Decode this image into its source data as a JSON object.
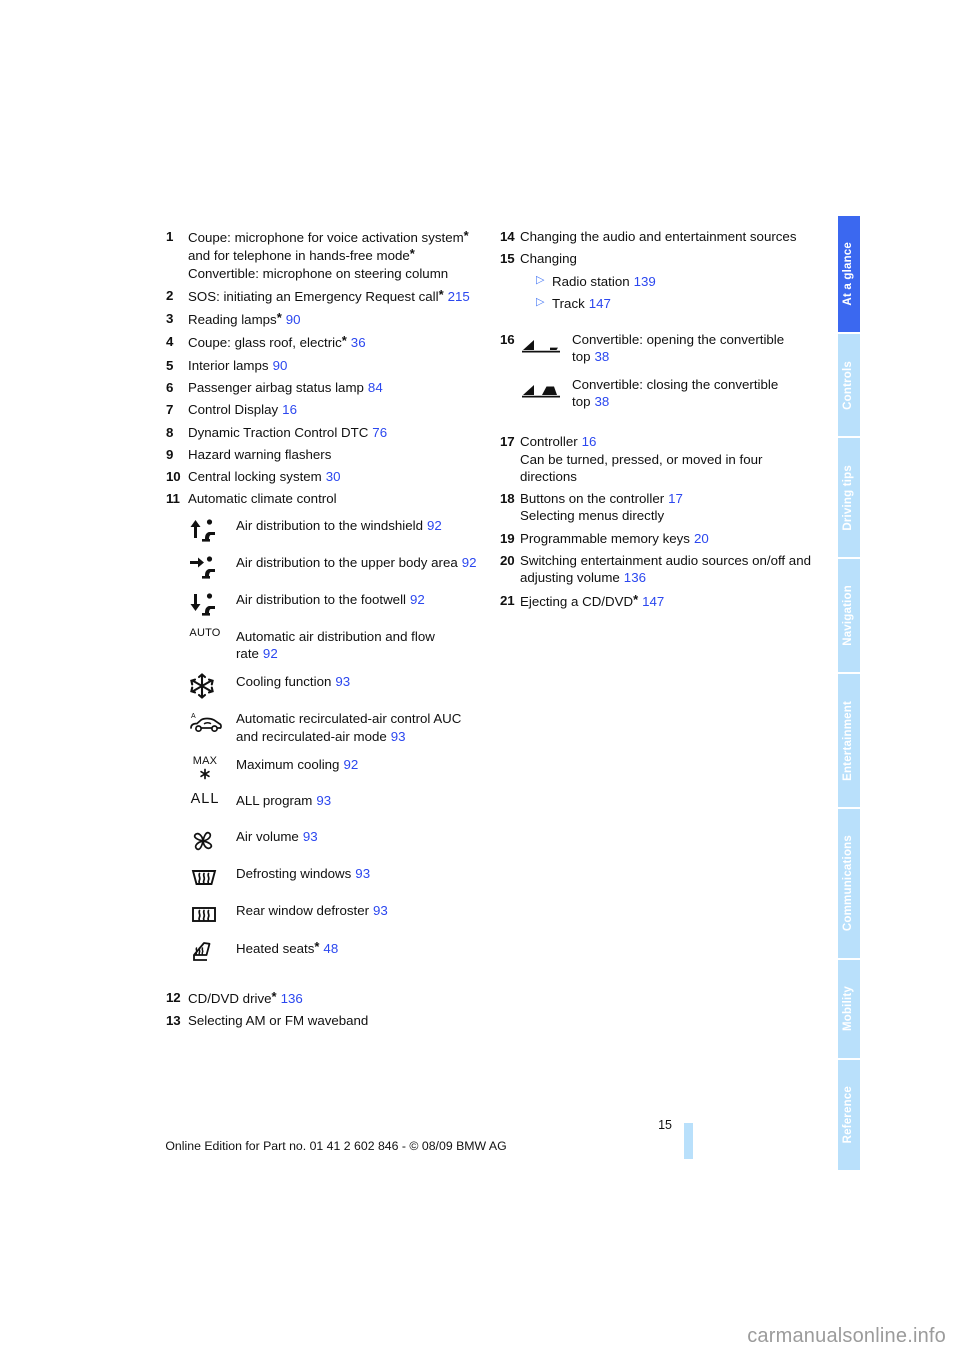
{
  "document": {
    "page_number": "15",
    "footer_text": "Online Edition for Part no. 01 41 2 602 846 - © 08/09 BMW AG",
    "watermark": "carmanualsonline.info",
    "accent_color": "#2b47ef",
    "tab_active_color": "#3b68f0",
    "tab_inactive_color": "#b9e0fb"
  },
  "sidebar": {
    "tabs": [
      {
        "label": "At a glance",
        "active": true
      },
      {
        "label": "Controls",
        "active": false
      },
      {
        "label": "Driving tips",
        "active": false
      },
      {
        "label": "Navigation",
        "active": false
      },
      {
        "label": "Entertainment",
        "active": false
      },
      {
        "label": "Communications",
        "active": false
      },
      {
        "label": "Mobility",
        "active": false
      },
      {
        "label": "Reference",
        "active": false
      }
    ]
  },
  "left_column": {
    "items": [
      {
        "num": "1",
        "lines": [
          "Coupe: microphone for voice activation system* and for telephone in hands-free mode*",
          "Convertible: microphone on steering column"
        ]
      },
      {
        "num": "2",
        "text": "SOS: initiating an Emergency Request call*",
        "page": "215"
      },
      {
        "num": "3",
        "text": "Reading lamps*",
        "page": "90"
      },
      {
        "num": "4",
        "text": "Coupe: glass roof, electric*",
        "page": "36"
      },
      {
        "num": "5",
        "text": "Interior lamps",
        "page": "90"
      },
      {
        "num": "6",
        "text": "Passenger airbag status lamp",
        "page": "84"
      },
      {
        "num": "7",
        "text": "Control Display",
        "page": "16"
      },
      {
        "num": "8",
        "text": "Dynamic Traction Control DTC",
        "page": "76"
      },
      {
        "num": "9",
        "text": "Hazard warning flashers",
        "page": ""
      },
      {
        "num": "10",
        "text": "Central locking system",
        "page": "30"
      },
      {
        "num": "11",
        "text": "Automatic climate control",
        "page": ""
      }
    ],
    "climate_icons": [
      {
        "icon": "air-distribution-windshield-icon",
        "label": "Air distribution to the windshield",
        "page": "92"
      },
      {
        "icon": "air-distribution-upper-body-icon",
        "label": "Air distribution to the upper body area",
        "page": "92"
      },
      {
        "icon": "air-distribution-footwell-icon",
        "label": "Air distribution to the footwell",
        "page": "92"
      },
      {
        "icon": "auto-icon",
        "glyph_text": "AUTO",
        "label": "Automatic air distribution and flow rate",
        "page": "92"
      },
      {
        "icon": "snowflake-cooling-icon",
        "label": "Cooling function",
        "page": "93"
      },
      {
        "icon": "recirculated-air-car-icon",
        "label": "Automatic recirculated-air control AUC and recirculated-air mode",
        "page": "93"
      },
      {
        "icon": "max-cooling-icon",
        "glyph_text": "MAX",
        "label": "Maximum cooling",
        "page": "92"
      },
      {
        "icon": "all-program-icon",
        "glyph_text": "ALL",
        "label": "ALL program",
        "page": "93"
      },
      {
        "icon": "fan-air-volume-icon",
        "label": "Air volume",
        "page": "93"
      },
      {
        "icon": "defrost-windshield-icon",
        "label": "Defrosting windows",
        "page": "93"
      },
      {
        "icon": "rear-window-defroster-icon",
        "label": "Rear window defroster",
        "page": "93"
      },
      {
        "icon": "heated-seats-icon",
        "label": "Heated seats*",
        "page": "48"
      }
    ],
    "items_after": [
      {
        "num": "12",
        "text": "CD/DVD drive*",
        "page": "136"
      },
      {
        "num": "13",
        "text": "Selecting AM or FM waveband",
        "page": ""
      }
    ]
  },
  "right_column": {
    "items": [
      {
        "num": "14",
        "text": "Changing the audio and entertainment sources",
        "page": ""
      },
      {
        "num": "15",
        "text": "Changing",
        "page": "",
        "sub": [
          {
            "label": "Radio station",
            "page": "139"
          },
          {
            "label": "Track",
            "page": "147"
          }
        ]
      }
    ],
    "convertible": {
      "num": "16",
      "rows": [
        {
          "icon": "convertible-top-open-icon",
          "label": "Convertible: opening the convertible top",
          "page": "38"
        },
        {
          "icon": "convertible-top-close-icon",
          "label": "Convertible: closing the convertible top",
          "page": "38"
        }
      ]
    },
    "items_after": [
      {
        "num": "17",
        "text": "Controller",
        "page": "16",
        "note": "Can be turned, pressed, or moved in four directions"
      },
      {
        "num": "18",
        "text": "Buttons on the controller",
        "page": "17",
        "note": "Selecting menus directly"
      },
      {
        "num": "19",
        "text": "Programmable memory keys",
        "page": "20",
        "note": ""
      },
      {
        "num": "20",
        "text": "Switching entertainment audio sources on/off and adjusting volume",
        "page": "136",
        "note": ""
      },
      {
        "num": "21",
        "text": "Ejecting a CD/DVD*",
        "page": "147",
        "note": ""
      }
    ]
  }
}
